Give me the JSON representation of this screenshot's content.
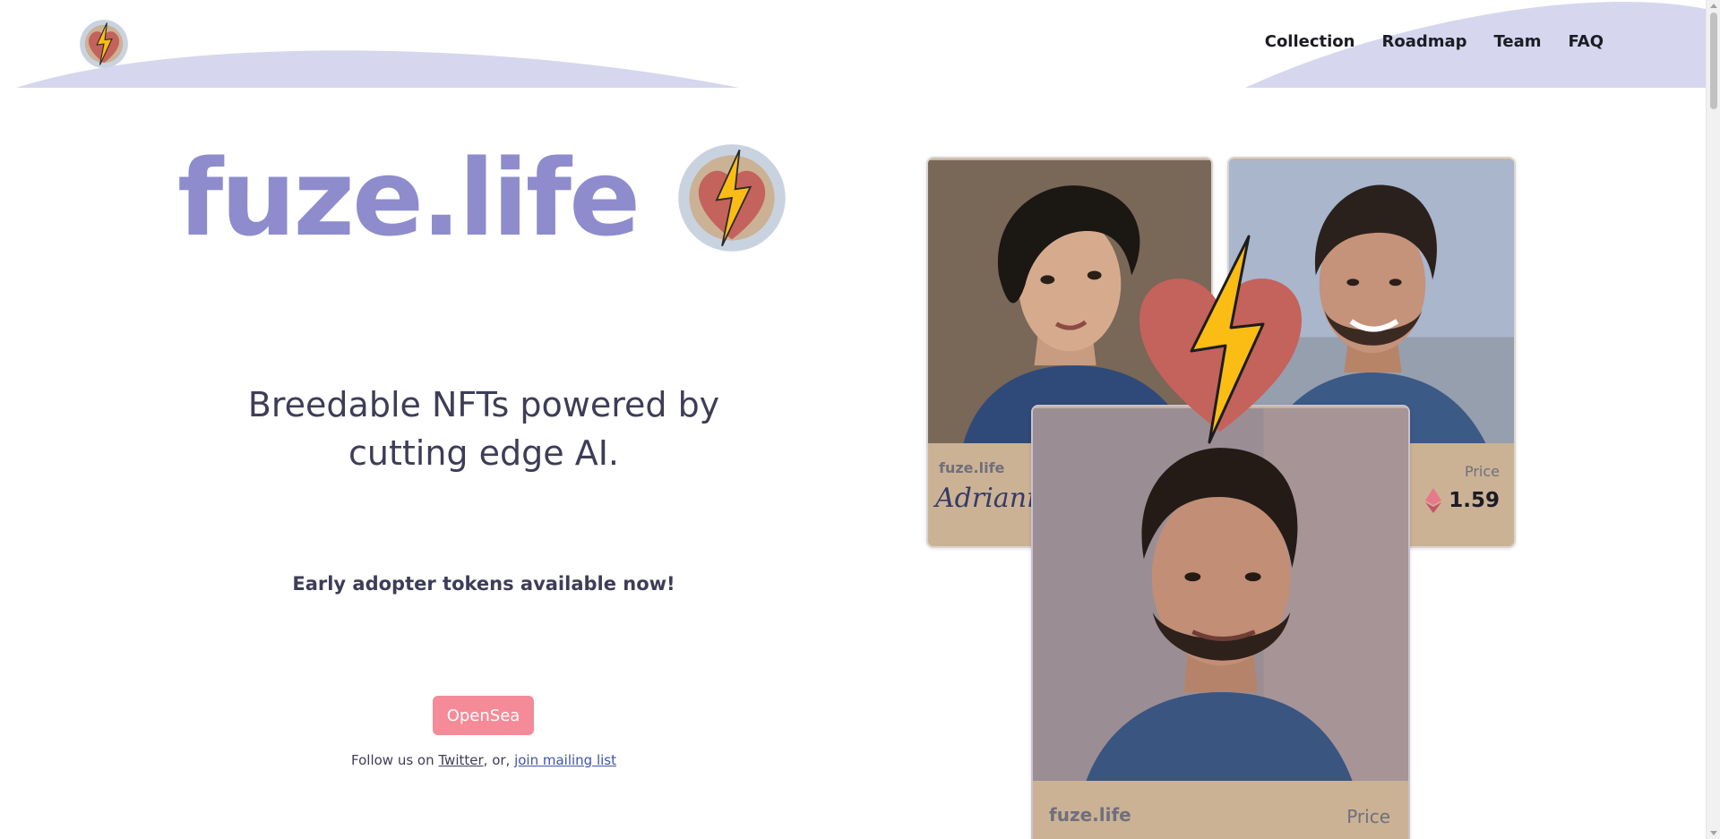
{
  "colors": {
    "brand_purple": "#8e8ccc",
    "wave": "#d6d6ee",
    "button_pink": "#f58b98",
    "card_tan": "#cbb295",
    "heart_red": "#c4625c",
    "bolt_yellow": "#fbbd14"
  },
  "header": {
    "logo_icon": "heart-lightning-icon",
    "nav": [
      "Collection",
      "Roadmap",
      "Team",
      "FAQ"
    ]
  },
  "hero": {
    "title": "fuze.life",
    "tagline_line1": "Breedable NFTs powered by",
    "tagline_line2": "cutting edge AI.",
    "early_access": "Early adopter tokens available now!",
    "button_label": "OpenSea",
    "follow_prefix": "Follow us on ",
    "twitter_link": "Twitter",
    "follow_middle": ", or, ",
    "mailing_link": "join mailing list"
  },
  "cards": {
    "left": {
      "brand": "fuze.life",
      "name": "Adrianna"
    },
    "right": {
      "price_label": "Price",
      "price": "1.59",
      "currency_icon": "ethereum-icon"
    },
    "front": {
      "brand": "fuze.life",
      "price_label": "Price"
    }
  }
}
